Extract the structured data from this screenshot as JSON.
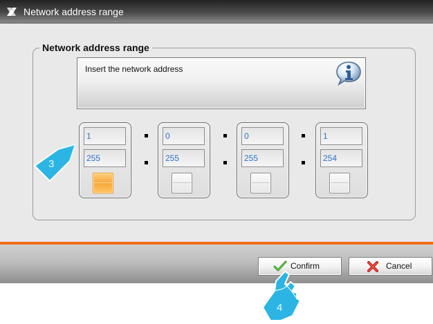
{
  "window": {
    "title": "Network address range",
    "logo": "app-logo-icon"
  },
  "group": {
    "legend": "Network address range"
  },
  "info": {
    "text": "Insert the network address",
    "icon": "info-icon"
  },
  "address_range": {
    "octets": [
      {
        "start": "1",
        "end": "255",
        "selected": true
      },
      {
        "start": "0",
        "end": "255",
        "selected": false
      },
      {
        "start": "0",
        "end": "255",
        "selected": false
      },
      {
        "start": "1",
        "end": "254",
        "selected": false
      }
    ],
    "separator_icon": "dot-separator-icon"
  },
  "buttons": {
    "confirm": {
      "label": "Confirm",
      "icon": "check-icon"
    },
    "cancel": {
      "label": "Cancel",
      "icon": "x-icon"
    }
  },
  "callouts": {
    "step_3": "3",
    "step_4": "4"
  },
  "colors": {
    "accent_orange": "#F06C19",
    "active_orange": "#F8A63C",
    "field_text_blue": "#2F73C8",
    "title_bar_dark": "#232323",
    "callout_blue": "#2CB5E4"
  }
}
